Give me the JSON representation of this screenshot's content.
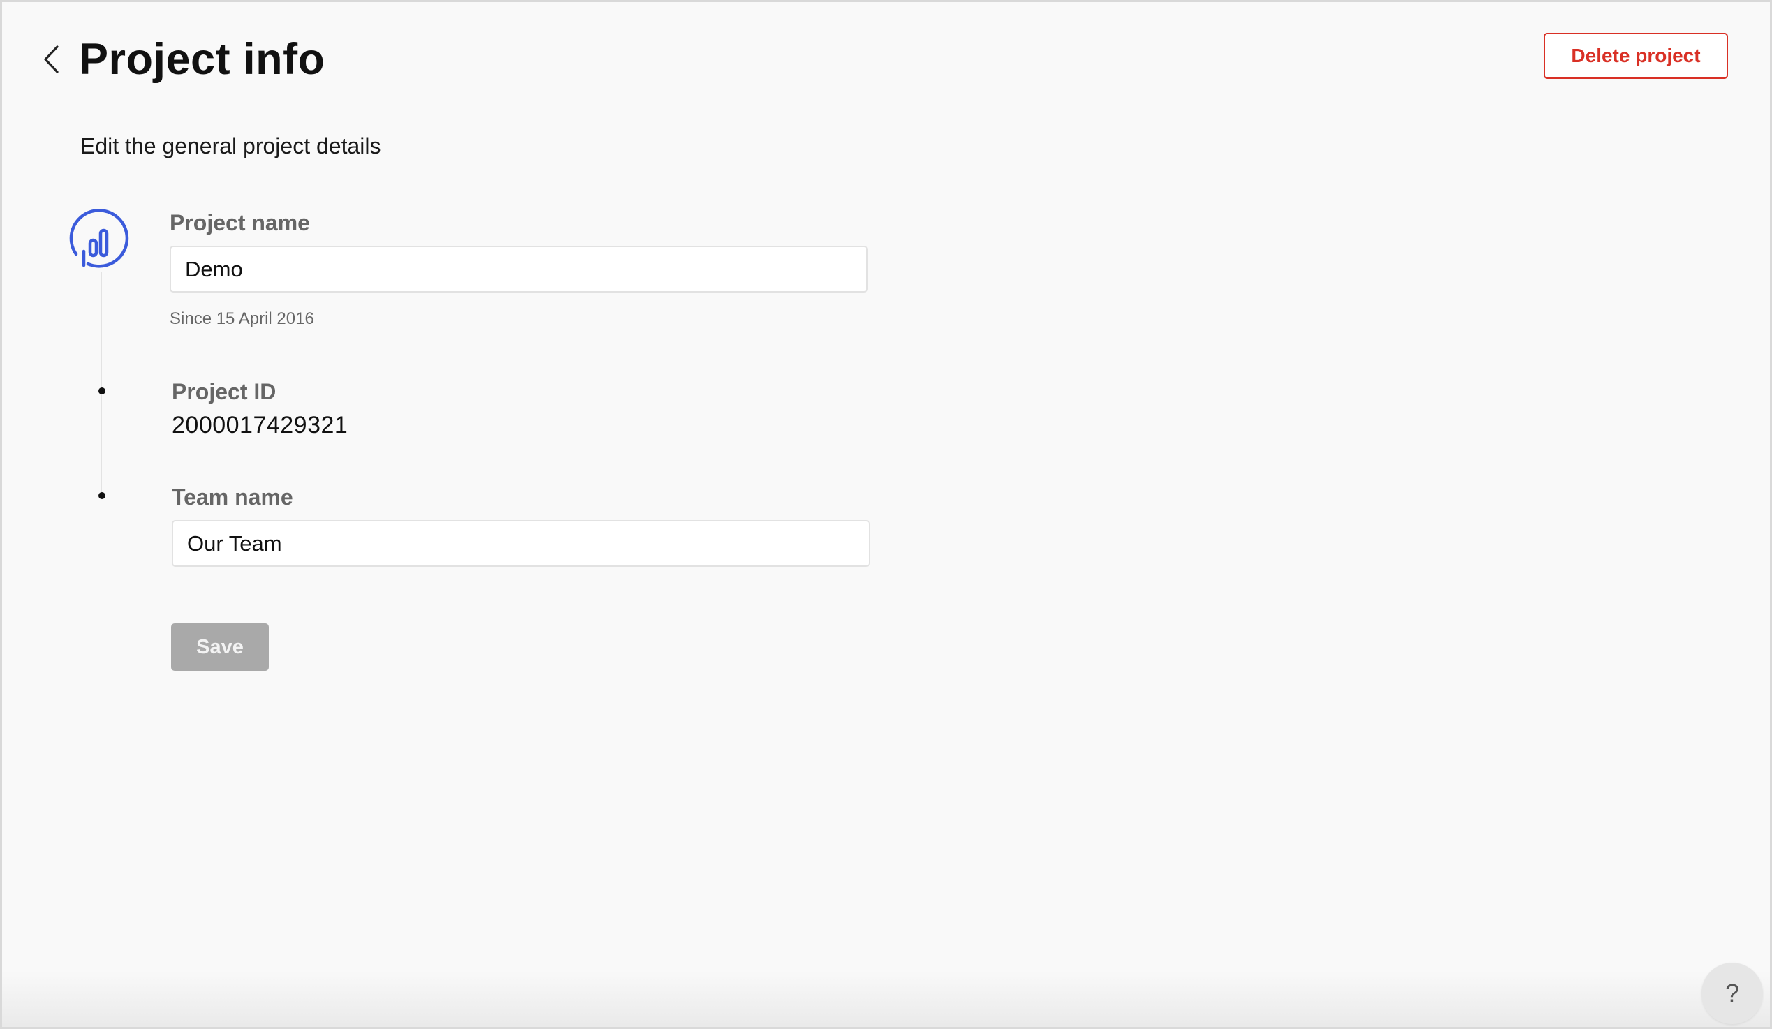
{
  "header": {
    "title": "Project info",
    "back_icon": "chevron-left-icon",
    "delete_label": "Delete project"
  },
  "subtitle": "Edit the general project details",
  "project_icon": "bar-chart-icon",
  "fields": {
    "project_name": {
      "label": "Project name",
      "value": "Demo",
      "since": "Since 15 April 2016"
    },
    "project_id": {
      "label": "Project ID",
      "value": "2000017429321"
    },
    "team_name": {
      "label": "Team name",
      "value": "Our Team"
    }
  },
  "save_label": "Save",
  "help_label": "?",
  "colors": {
    "accent": "#3b5bdb",
    "danger": "#d93025",
    "disabled_button": "#a9a9a9",
    "background": "#f9f9f9"
  }
}
